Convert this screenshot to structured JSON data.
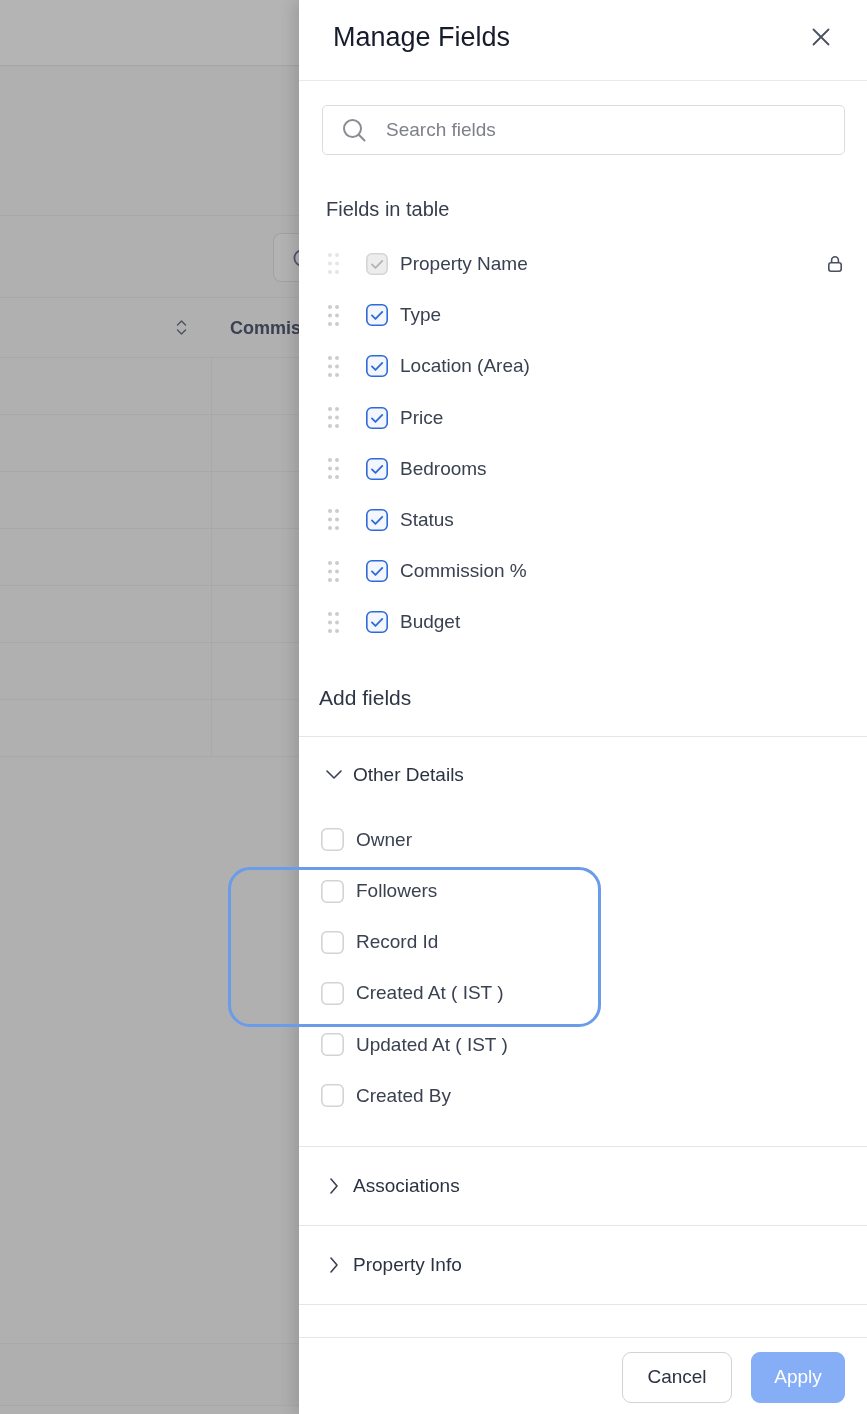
{
  "background_page": {
    "table": {
      "column_1": {
        "sortable": true
      },
      "column_2": {
        "label": "Commis"
      }
    }
  },
  "panel": {
    "title": "Manage Fields",
    "search": {
      "placeholder": "Search fields"
    }
  },
  "fields_in_table": {
    "title": "Fields in table",
    "items": [
      {
        "label": "Property Name",
        "checked": true,
        "disabled": true,
        "locked": true
      },
      {
        "label": "Type",
        "checked": true,
        "disabled": false,
        "locked": false
      },
      {
        "label": "Location (Area)",
        "checked": true,
        "disabled": false,
        "locked": false
      },
      {
        "label": "Price",
        "checked": true,
        "disabled": false,
        "locked": false
      },
      {
        "label": "Bedrooms",
        "checked": true,
        "disabled": false,
        "locked": false
      },
      {
        "label": "Status",
        "checked": true,
        "disabled": false,
        "locked": false
      },
      {
        "label": "Commission %",
        "checked": true,
        "disabled": false,
        "locked": false
      },
      {
        "label": "Budget",
        "checked": true,
        "disabled": false,
        "locked": false
      }
    ]
  },
  "add_fields": {
    "title": "Add fields",
    "sections": [
      {
        "title": "Other Details",
        "expanded": true,
        "items": [
          {
            "label": "Owner",
            "checked": false,
            "highlighted": false
          },
          {
            "label": "Followers",
            "checked": false,
            "highlighted": true
          },
          {
            "label": "Record Id",
            "checked": false,
            "highlighted": true
          },
          {
            "label": "Created At ( IST )",
            "checked": false,
            "highlighted": true
          },
          {
            "label": "Updated At ( IST )",
            "checked": false,
            "highlighted": false
          },
          {
            "label": "Created By",
            "checked": false,
            "highlighted": false
          }
        ]
      },
      {
        "title": "Associations",
        "expanded": false
      },
      {
        "title": "Property Info",
        "expanded": false
      }
    ]
  },
  "footer": {
    "buttons": [
      {
        "label": "Cancel",
        "kind": "secondary",
        "disabled": false
      },
      {
        "label": "Apply",
        "kind": "primary",
        "disabled": true
      }
    ]
  }
}
